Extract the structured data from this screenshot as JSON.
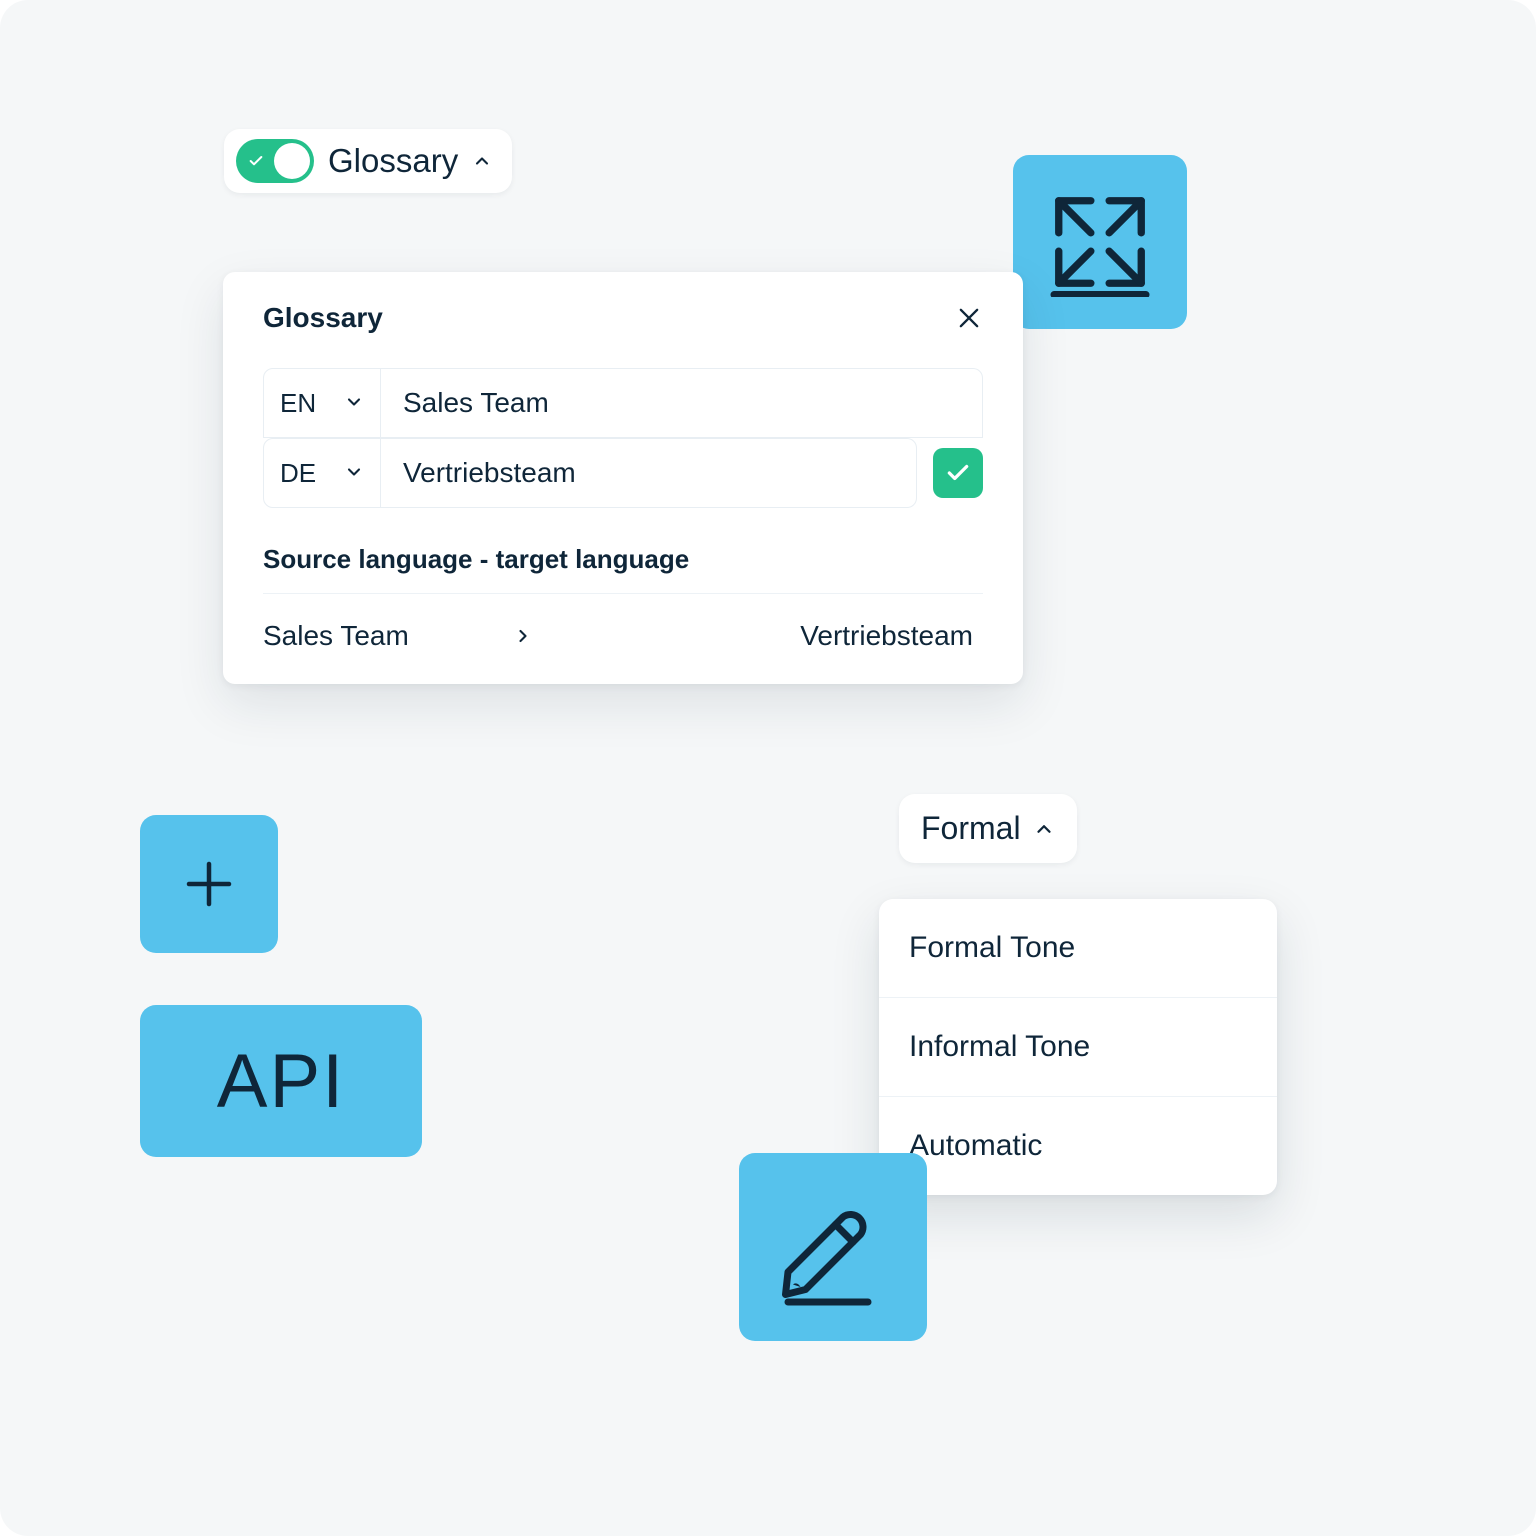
{
  "glossary_chip": {
    "label": "Glossary",
    "enabled": true
  },
  "glossary_panel": {
    "title": "Glossary",
    "inputs": [
      {
        "lang": "EN",
        "term": "Sales Team"
      },
      {
        "lang": "DE",
        "term": "Vertriebsteam"
      }
    ],
    "section_label": "Source language - target language",
    "entries": [
      {
        "source": "Sales Team",
        "target": "Vertriebsteam"
      }
    ]
  },
  "tone": {
    "selected": "Formal",
    "options": [
      "Formal Tone",
      "Informal Tone",
      "Automatic"
    ]
  },
  "tiles": {
    "api_label": "API"
  }
}
